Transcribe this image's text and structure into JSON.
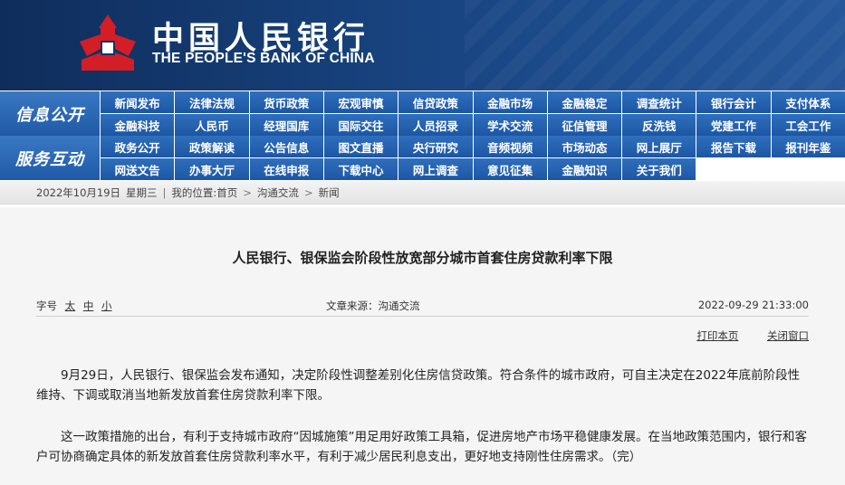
{
  "header": {
    "logo_cn": "中国人民银行",
    "logo_en": "THE PEOPLE'S BANK OF CHINA",
    "logo_icon": "pboc-emblem-icon",
    "brand_color": "#d31e25"
  },
  "nav": {
    "info_label": "信息公开",
    "service_label": "服务互动",
    "info_items": [
      "新闻发布",
      "法律法规",
      "货币政策",
      "宏观审慎",
      "信贷政策",
      "金融市场",
      "金融稳定",
      "调查统计",
      "银行会计",
      "支付体系",
      "金融科技",
      "人民币",
      "经理国库",
      "国际交往",
      "人员招录",
      "学术交流",
      "征信管理",
      "反洗钱",
      "党建工作",
      "工会工作"
    ],
    "service_items": [
      "政务公开",
      "政策解读",
      "公告信息",
      "图文直播",
      "央行研究",
      "音频视频",
      "市场动态",
      "网上展厅",
      "报告下载",
      "报刊年鉴",
      "网送文告",
      "办事大厅",
      "在线申报",
      "下载中心",
      "网上调查",
      "意见征集",
      "金融知识",
      "关于我们"
    ]
  },
  "breadcrumb": {
    "date": "2022年10月19日",
    "weekday": "星期三",
    "location_label": "我的位置:",
    "items": [
      "首页",
      "沟通交流",
      "新闻"
    ]
  },
  "article": {
    "title": "人民银行、银保监会阶段性放宽部分城市首套住房贷款利率下限",
    "font_label": "字号",
    "font_large": "太",
    "font_medium": "中",
    "font_small": "小",
    "source": "文章来源：沟通交流",
    "datetime": "2022-09-29 21:33:00",
    "print_label": "打印本页",
    "close_label": "关闭窗口",
    "paragraphs": [
      "9月29日，人民银行、银保监会发布通知，决定阶段性调整差别化住房信贷政策。符合条件的城市政府，可自主决定在2022年底前阶段性维持、下调或取消当地新发放首套住房贷款利率下限。",
      "这一政策措施的出台，有利于支持城市政府“因城施策”用足用好政策工具箱，促进房地产市场平稳健康发展。在当地政策范围内，银行和客户可协商确定具体的新发放首套住房贷款利率水平，有利于减少居民利息支出，更好地支持刚性住房需求。（完）"
    ]
  }
}
